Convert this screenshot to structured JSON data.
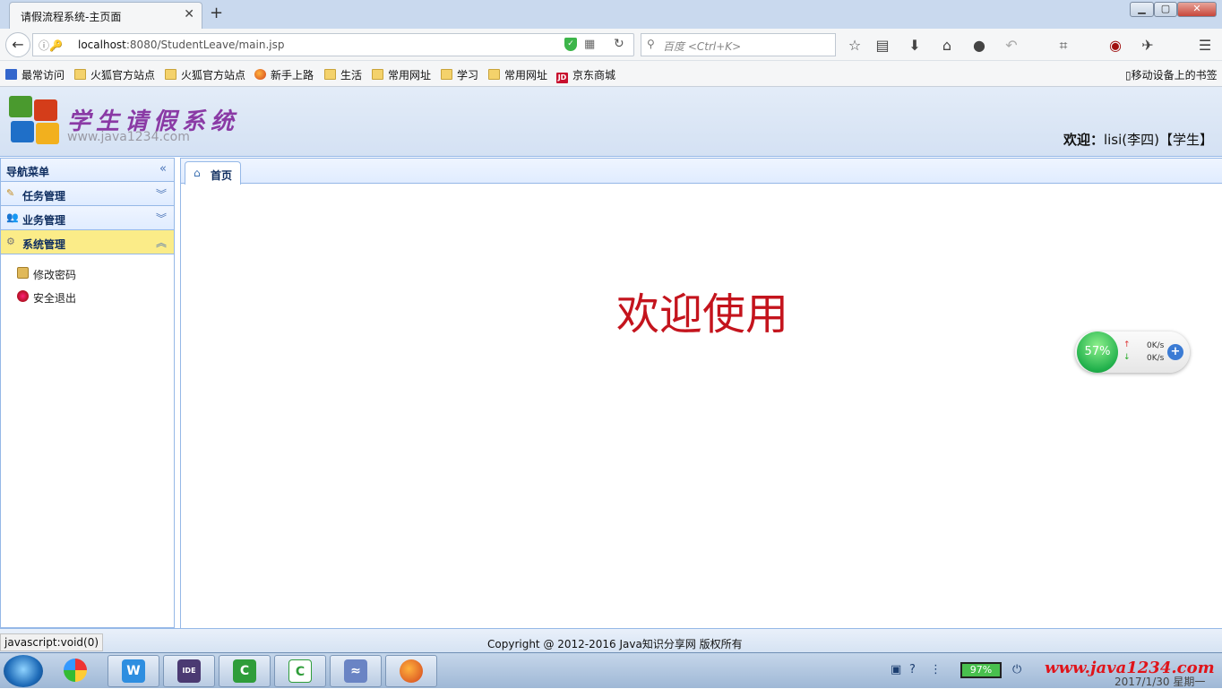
{
  "browser": {
    "tab_title": "请假流程系统-主页面",
    "tab_close": "✕",
    "new_tab": "+",
    "win_min": "▁",
    "win_max": "▢",
    "win_close": "✕",
    "url_host": "localhost",
    "url_rest": ":8080/StudentLeave/main.jsp",
    "search_placeholder": "百度 <Ctrl+K>",
    "bookmarks": [
      "最常访问",
      "火狐官方站点",
      "火狐官方站点",
      "新手上路",
      "生活",
      "常用网址",
      "学习",
      "常用网址",
      "京东商城"
    ],
    "mobile_bookmarks": "移动设备上的书签",
    "jd_badge": "JD",
    "status_text": "javascript:void(0)"
  },
  "app": {
    "title": "学生请假系统",
    "site_url": "www.java1234.com",
    "welcome_label": "欢迎：",
    "welcome_user": "lisi(李四)【学生】"
  },
  "sidebar": {
    "header": "导航菜单",
    "sections": [
      {
        "label": "任务管理",
        "icon": "edit-icon"
      },
      {
        "label": "业务管理",
        "icon": "users-icon"
      },
      {
        "label": "系统管理",
        "icon": "settings-icon"
      }
    ],
    "items": [
      {
        "label": "修改密码",
        "icon": "password-icon"
      },
      {
        "label": "安全退出",
        "icon": "exit-icon"
      }
    ]
  },
  "main": {
    "tab_home": "首页",
    "welcome_text": "欢迎使用"
  },
  "speed_widget": {
    "percent": "57%",
    "upload": "0K/s",
    "download": "0K/s"
  },
  "footer": {
    "copyright": "Copyright @ 2012-2016 Java知识分享网 版权所有"
  },
  "taskbar": {
    "battery": "97%",
    "watermark": "www.java1234.com",
    "date": "2017/1/30 星期一"
  },
  "colors": {
    "accent_border": "#95b8e7",
    "active_section": "#fbec88",
    "welcome_red": "#c4141d",
    "title_purple": "#8a3aa5"
  }
}
